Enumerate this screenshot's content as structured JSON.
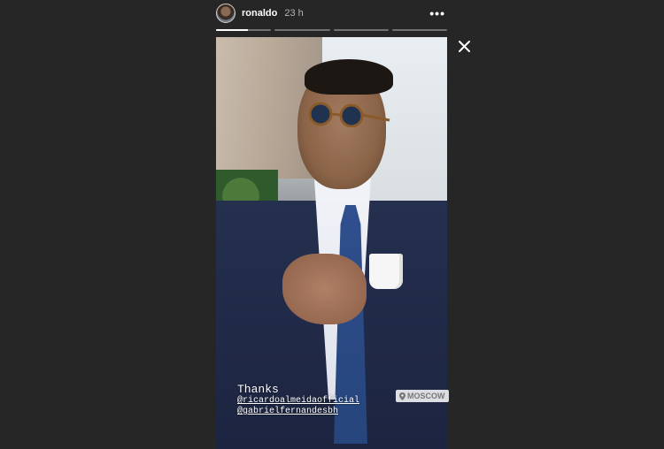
{
  "header": {
    "username": "ronaldo",
    "time": "23 h",
    "more_icon": "more-horizontal-icon"
  },
  "progress": {
    "segments": [
      {
        "fill": 0.58
      },
      {
        "fill": 0
      },
      {
        "fill": 0
      },
      {
        "fill": 0
      }
    ]
  },
  "close_icon": "close-icon",
  "story": {
    "caption_title": "Thanks",
    "mention_1": "@ricardoalmeidaofficial",
    "mention_2": "@gabrielfernandesbh",
    "location_sticker": "MOSCOW",
    "location_icon": "pin-icon"
  },
  "colors": {
    "background": "#262626",
    "text": "#ffffff",
    "muted": "#b5b5b5"
  }
}
